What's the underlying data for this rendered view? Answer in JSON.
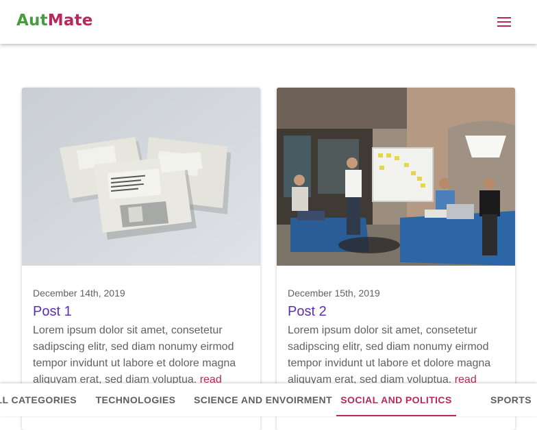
{
  "header": {
    "logo_part1": "Aut",
    "logo_part2": "Mate",
    "menu_icon": "menu-icon"
  },
  "posts": [
    {
      "date": "December 14th, 2019",
      "title": "Post 1",
      "excerpt": "Lorem ipsum dolor sit amet, consetetur sadipscing elitr, sed diam nonumy eirmod tempor invidunt ut labore et dolore magna aliquyam erat, sed diam voluptua.",
      "read_label": "read",
      "image_icon": "floppy-disks-image"
    },
    {
      "date": "December 15th, 2019",
      "title": "Post 2",
      "excerpt": "Lorem ipsum dolor sit amet, consetetur sadipscing elitr, sed diam nonumy eirmod tempor invidunt ut labore et dolore magna aliquyam erat, sed diam voluptua.",
      "read_label": "read",
      "image_icon": "office-meeting-image"
    }
  ],
  "tabs": {
    "items": [
      "ALL CATEGORIES",
      "TECHNOLOGIES",
      "SCIENCE AND ENVOIRMENT",
      "SOCIAL AND POLITICS",
      "SPORTS"
    ],
    "active": "SOCIAL AND POLITICS"
  },
  "colors": {
    "brand_green": "#4a9a3f",
    "brand_magenta": "#b8285a",
    "title_purple": "#5b2fb0"
  }
}
